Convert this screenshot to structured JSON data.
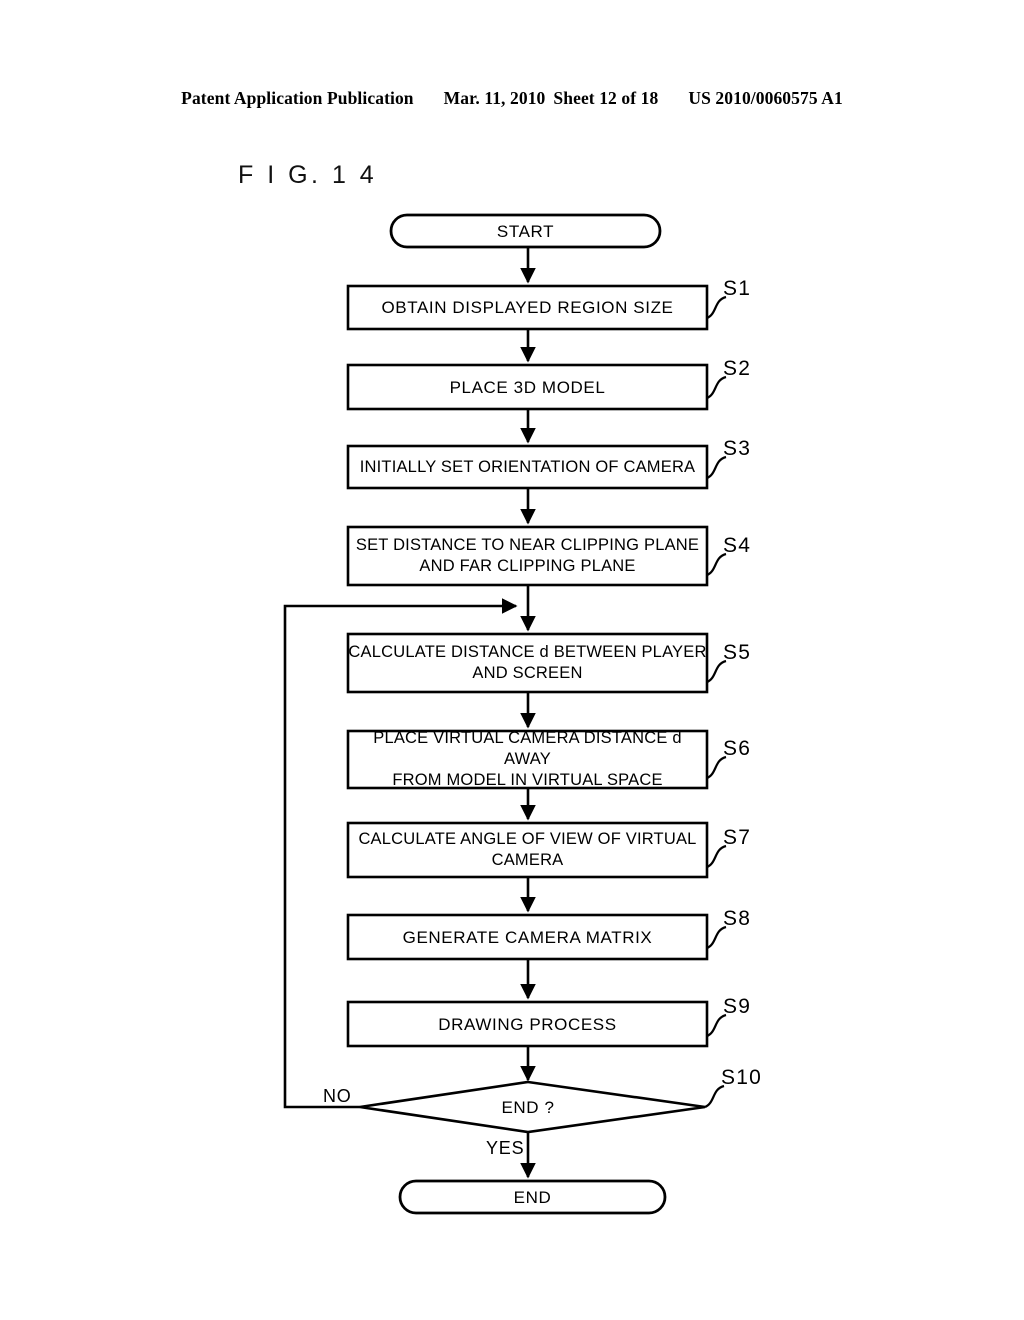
{
  "header": {
    "publication": "Patent Application Publication",
    "date": "Mar. 11, 2010",
    "sheet": "Sheet 12 of 18",
    "patent_number": "US 2010/0060575 A1"
  },
  "figure": {
    "label": "F I G.  1 4"
  },
  "flowchart": {
    "start": {
      "text": "START"
    },
    "end": {
      "text": "END"
    },
    "steps": [
      {
        "id": "S1",
        "text": "OBTAIN DISPLAYED REGION SIZE"
      },
      {
        "id": "S2",
        "text": "PLACE 3D MODEL"
      },
      {
        "id": "S3",
        "text": "INITIALLY SET ORIENTATION OF CAMERA"
      },
      {
        "id": "S4",
        "text": "SET DISTANCE TO NEAR CLIPPING PLANE\nAND FAR CLIPPING PLANE"
      },
      {
        "id": "S5",
        "text": "CALCULATE DISTANCE d BETWEEN PLAYER\nAND SCREEN"
      },
      {
        "id": "S6",
        "text": "PLACE VIRTUAL CAMERA DISTANCE d AWAY\nFROM MODEL IN VIRTUAL SPACE"
      },
      {
        "id": "S7",
        "text": "CALCULATE ANGLE OF VIEW OF VIRTUAL\nCAMERA"
      },
      {
        "id": "S8",
        "text": "GENERATE CAMERA MATRIX"
      },
      {
        "id": "S9",
        "text": "DRAWING PROCESS"
      },
      {
        "id": "S10",
        "text": "END ?"
      }
    ],
    "decision": {
      "id": "S10",
      "text": "END ?",
      "no_label": "NO",
      "yes_label": "YES"
    },
    "colors": {
      "stroke": "#000000",
      "fill": "#ffffff",
      "background": "#ffffff"
    }
  }
}
